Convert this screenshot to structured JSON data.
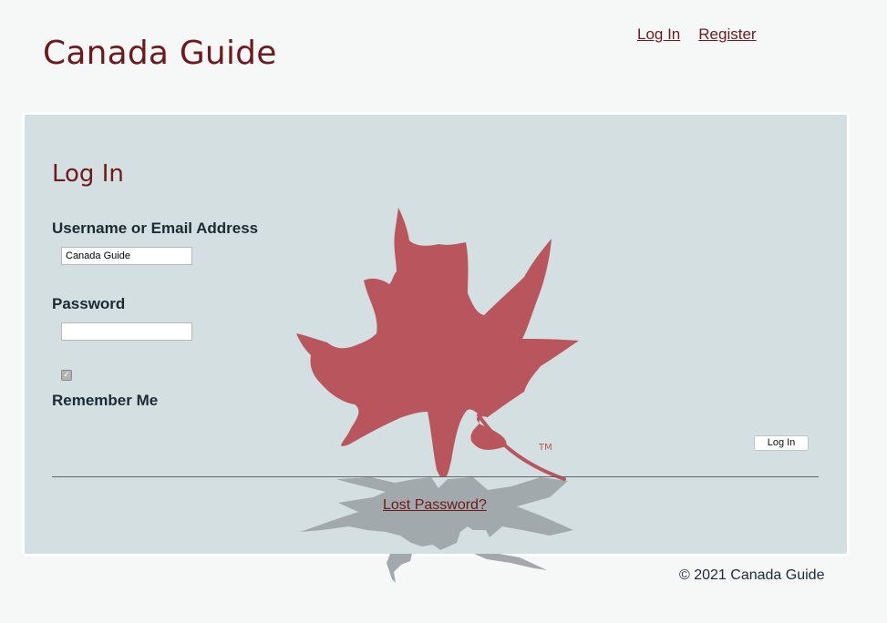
{
  "header": {
    "site_title": "Canada Guide",
    "nav": {
      "login": "Log In",
      "register": "Register"
    }
  },
  "login_form": {
    "title": "Log In",
    "username_label": "Username or Email Address",
    "username_value": "Canada Guide",
    "password_label": "Password",
    "password_value": "",
    "remember_me_label": "Remember Me",
    "remember_me_checked": true,
    "submit_label": "Log In",
    "lost_password_link": "Lost Password?"
  },
  "logo": {
    "icon": "maple-leaf-icon",
    "trademark": "TM",
    "leaf_color": "#b9565d",
    "reflection_color": "#a2a9ad"
  },
  "footer": {
    "copyright": "© 2021 Canada Guide"
  },
  "colors": {
    "brand": "#6e1a1c",
    "page_background": "#f6f8f8",
    "card_background": "#d3dfe1",
    "label_text": "#1c2b33"
  }
}
